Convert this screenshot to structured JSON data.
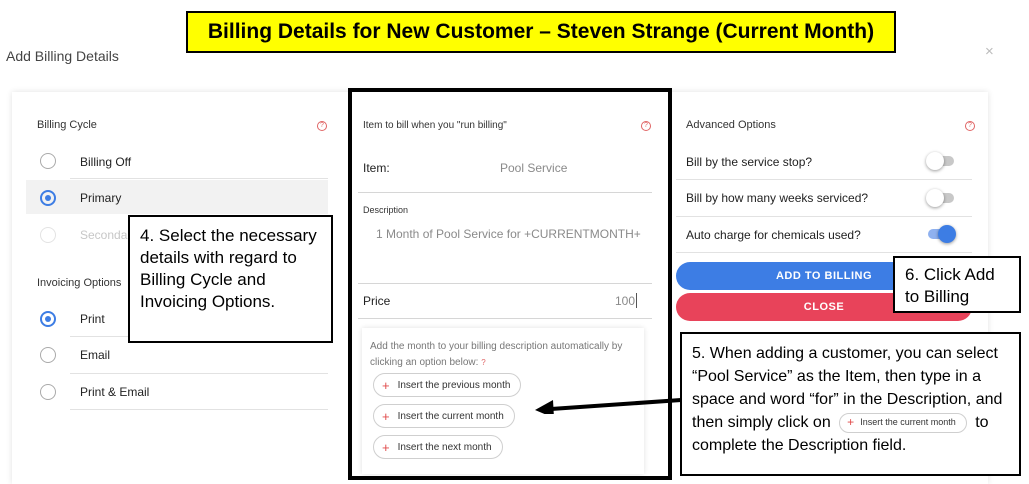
{
  "banner": "Billing Details for New Customer – Steven Strange (Current Month)",
  "dialog": {
    "title": "Add Billing Details",
    "close": "×"
  },
  "billing_cycle": {
    "title": "Billing Cycle",
    "help": "?",
    "options": [
      {
        "label": "Billing Off",
        "state": "unchecked"
      },
      {
        "label": "Primary",
        "state": "checked"
      },
      {
        "label": "Secondary",
        "state": "disabled"
      }
    ]
  },
  "invoicing": {
    "title": "Invoicing Options",
    "options": [
      {
        "label": "Print",
        "state": "checked"
      },
      {
        "label": "Email",
        "state": "unchecked"
      },
      {
        "label": "Print & Email",
        "state": "unchecked"
      }
    ]
  },
  "item_panel": {
    "title": "Item to bill when you \"run billing\"",
    "help": "?",
    "item_label": "Item:",
    "item_value": "Pool Service",
    "description_label": "Description",
    "description_value": "1 Month of Pool Service for +CURRENTMONTH+",
    "price_label": "Price",
    "price_value": "100",
    "month_hint": "Add the month to your billing description automatically by clicking an option below:",
    "month_hint_help": "?",
    "chips": [
      {
        "icon": "plus-icon",
        "label": "Insert the previous month"
      },
      {
        "icon": "plus-icon",
        "label": "Insert the current month"
      },
      {
        "icon": "plus-icon",
        "label": "Insert the next month"
      }
    ]
  },
  "advanced": {
    "title": "Advanced Options",
    "help": "?",
    "options": [
      {
        "label": "Bill by the service stop?",
        "on": false
      },
      {
        "label": "Bill by how many weeks serviced?",
        "on": false
      },
      {
        "label": "Auto charge for chemicals used?",
        "on": true
      }
    ],
    "add_button": "ADD TO BILLING",
    "close_button": "CLOSE"
  },
  "callouts": {
    "step4": "4. Select the necessary details with regard to Billing Cycle and Invoicing Options.",
    "step6": "6. Click Add to Billing",
    "step5_before": "5. When adding a customer, you  can select “Pool Service” as the Item, then type in a space and word “for” in the Description, and then simply click on",
    "step5_chip": "Insert the current month",
    "step5_after": "to complete the Description field."
  },
  "colors": {
    "accent": "#3d7de4",
    "danger": "#e8435a",
    "banner": "#ffff00"
  }
}
